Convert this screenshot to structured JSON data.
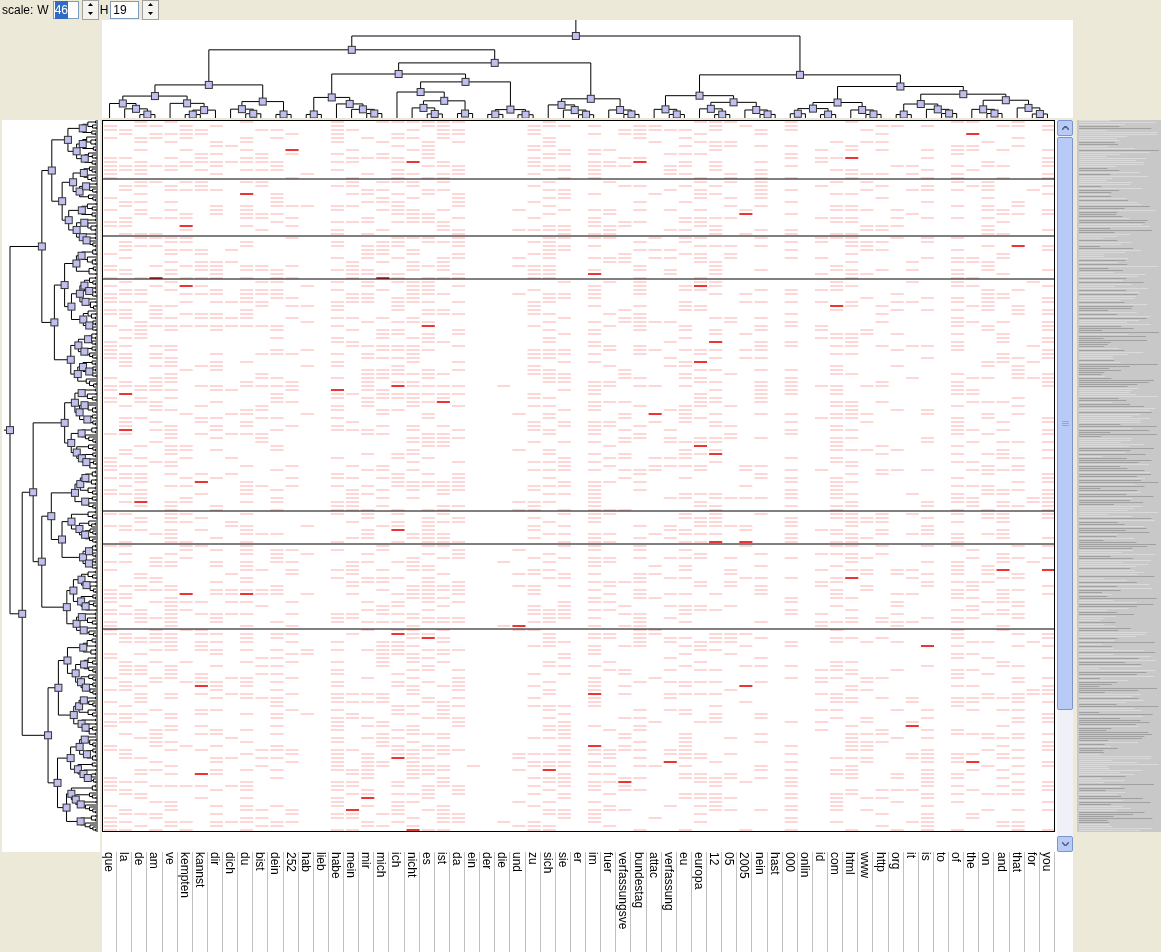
{
  "toolbar": {
    "scale_label": "scale:",
    "width_label": "W",
    "width_value": "46",
    "width_text_selected": true,
    "height_label": "H",
    "height_value": "19",
    "height_text_selected": false
  },
  "heatmap": {
    "column_labels": [
      "que",
      "la",
      "de",
      "am",
      "ve",
      "kempten",
      "kannst",
      "dir",
      "dich",
      "du",
      "bist",
      "dein",
      "252",
      "hab",
      "lieb",
      "habe",
      "mein",
      "mir",
      "mich",
      "ich",
      "nicht",
      "es",
      "ist",
      "da",
      "ein",
      "der",
      "die",
      "und",
      "zu",
      "sich",
      "sie",
      "er",
      "im",
      "fuer",
      "verfassungsve",
      "bundestag",
      "attac",
      "verfassung",
      "eu",
      "europa",
      "12",
      "05",
      "2005",
      "nein",
      "hast",
      "000",
      "onlin",
      "id",
      "com",
      "html",
      "www",
      "http",
      "org",
      "it",
      "is",
      "to",
      "of",
      "the",
      "on",
      "and",
      "that",
      "for",
      "you"
    ]
  }
}
